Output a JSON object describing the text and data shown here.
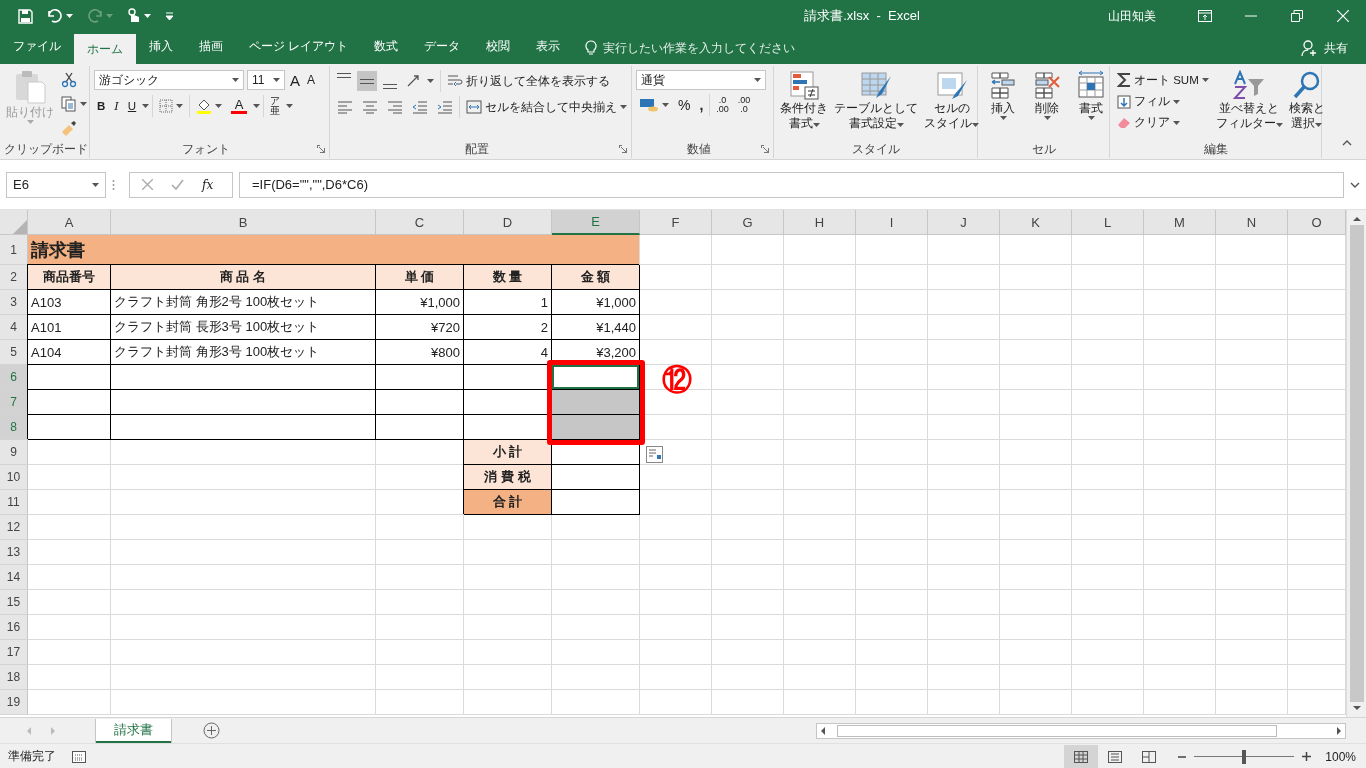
{
  "window": {
    "title": "請求書.xlsx  -  Excel",
    "user": "山田知美"
  },
  "tabs": [
    {
      "label": "ファイル",
      "selected": false
    },
    {
      "label": "ホーム",
      "selected": true
    },
    {
      "label": "挿入",
      "selected": false
    },
    {
      "label": "描画",
      "selected": false
    },
    {
      "label": "ページ レイアウト",
      "selected": false
    },
    {
      "label": "数式",
      "selected": false
    },
    {
      "label": "データ",
      "selected": false
    },
    {
      "label": "校閲",
      "selected": false
    },
    {
      "label": "表示",
      "selected": false
    }
  ],
  "tell_me": {
    "placeholder": "実行したい作業を入力してください"
  },
  "share": "共有",
  "ribbon": {
    "groups": [
      {
        "kind": "clipboard",
        "label": "クリップボード",
        "paste": {
          "label": "貼り付け",
          "disabled": true
        }
      },
      {
        "kind": "font",
        "label": "フォント",
        "font_name": "游ゴシック",
        "font_size": "11",
        "grow": "A",
        "shrink": "A",
        "bold": "B",
        "italic": "I",
        "underline": "U",
        "font_color": "A",
        "phonetic": [
          "ア",
          "亜"
        ]
      },
      {
        "kind": "alignment",
        "label": "配置",
        "vertical": [
          {
            "selected": false
          },
          {
            "selected": true
          },
          {
            "selected": false
          }
        ],
        "wrap": "折り返して全体を表示する",
        "merge": "セルを結合して中央揃え"
      },
      {
        "kind": "number",
        "label": "数値",
        "format": "通貨",
        "percent": "%",
        "comma": ",",
        "increase_decimal": [
          ".0",
          ".00"
        ],
        "decrease_decimal": [
          ".00",
          ".0"
        ]
      },
      {
        "kind": "styles",
        "label": "スタイル",
        "buttons": [
          {
            "lines": [
              "条件付き",
              "書式"
            ]
          },
          {
            "lines": [
              "テーブルとして",
              "書式設定"
            ]
          },
          {
            "lines": [
              "セルの",
              "スタイル"
            ]
          }
        ]
      },
      {
        "kind": "cells",
        "label": "セル",
        "buttons": [
          {
            "label": "挿入"
          },
          {
            "label": "削除"
          },
          {
            "label": "書式"
          }
        ]
      },
      {
        "kind": "editing",
        "label": "編集",
        "autosum": "オート SUM",
        "fill": "フィル",
        "clear": "クリア",
        "buttons": [
          {
            "lines": [
              "並べ替えと",
              "フィルター"
            ]
          },
          {
            "lines": [
              "検索と",
              "選択"
            ]
          }
        ]
      }
    ]
  },
  "formula_bar": {
    "name_box": "E6",
    "fx": "fx",
    "formula": "=IF(D6=\"\",\"\",D6*C6)"
  },
  "sheet": {
    "columns": [
      {
        "label": "A",
        "selected": false
      },
      {
        "label": "B",
        "selected": false
      },
      {
        "label": "C",
        "selected": false
      },
      {
        "label": "D",
        "selected": false
      },
      {
        "label": "E",
        "selected": true
      },
      {
        "label": "F",
        "selected": false
      },
      {
        "label": "G",
        "selected": false
      },
      {
        "label": "H",
        "selected": false
      },
      {
        "label": "I",
        "selected": false
      },
      {
        "label": "J",
        "selected": false
      },
      {
        "label": "K",
        "selected": false
      },
      {
        "label": "L",
        "selected": false
      },
      {
        "label": "M",
        "selected": false
      },
      {
        "label": "N",
        "selected": false
      },
      {
        "label": "O",
        "selected": false
      }
    ],
    "rows": [
      {
        "label": "1",
        "selected": false,
        "cells": [
          {
            "kind": "title",
            "text": "請求書",
            "selected": false
          }
        ]
      },
      {
        "label": "2",
        "selected": false,
        "cells": [
          {
            "kind": "header",
            "text": "商品番号",
            "selected": false
          },
          {
            "kind": "header",
            "text": "商 品 名",
            "selected": false
          },
          {
            "kind": "header",
            "text": "単 価",
            "selected": false
          },
          {
            "kind": "header",
            "text": "数 量",
            "selected": false
          },
          {
            "kind": "header",
            "text": "金 額",
            "selected": false
          }
        ]
      },
      {
        "label": "3",
        "selected": false,
        "cells": [
          {
            "kind": "text",
            "text": "A103",
            "selected": false
          },
          {
            "kind": "text",
            "text": "クラフト封筒 角形2号 100枚セット",
            "selected": false
          },
          {
            "kind": "number",
            "text": "¥1,000",
            "selected": false
          },
          {
            "kind": "number",
            "text": "1",
            "selected": false
          },
          {
            "kind": "number",
            "text": "¥1,000",
            "selected": false
          }
        ]
      },
      {
        "label": "4",
        "selected": false,
        "cells": [
          {
            "kind": "text",
            "text": "A101",
            "selected": false
          },
          {
            "kind": "text",
            "text": "クラフト封筒 長形3号 100枚セット",
            "selected": false
          },
          {
            "kind": "number",
            "text": "¥720",
            "selected": false
          },
          {
            "kind": "number",
            "text": "2",
            "selected": false
          },
          {
            "kind": "number",
            "text": "¥1,440",
            "selected": false
          }
        ]
      },
      {
        "label": "5",
        "selected": false,
        "cells": [
          {
            "kind": "text",
            "text": "A104",
            "selected": false
          },
          {
            "kind": "text",
            "text": "クラフト封筒 角形3号 100枚セット",
            "selected": false
          },
          {
            "kind": "number",
            "text": "¥800",
            "selected": false
          },
          {
            "kind": "number",
            "text": "4",
            "selected": false
          },
          {
            "kind": "number",
            "text": "¥3,200",
            "selected": false
          }
        ]
      },
      {
        "label": "6",
        "selected": true,
        "cells": [
          {
            "kind": "blank",
            "selected": false
          },
          {
            "kind": "blank",
            "selected": false
          },
          {
            "kind": "blank",
            "selected": false
          },
          {
            "kind": "blank",
            "selected": false
          },
          {
            "kind": "blank",
            "selected": true
          }
        ]
      },
      {
        "label": "7",
        "selected": true,
        "cells": [
          {
            "kind": "blank",
            "selected": false
          },
          {
            "kind": "blank",
            "selected": false
          },
          {
            "kind": "blank",
            "selected": false
          },
          {
            "kind": "blank",
            "selected": false
          },
          {
            "kind": "blank",
            "selected": true
          }
        ]
      },
      {
        "label": "8",
        "selected": true,
        "cells": [
          {
            "kind": "blank",
            "selected": false
          },
          {
            "kind": "blank",
            "selected": false
          },
          {
            "kind": "blank",
            "selected": false
          },
          {
            "kind": "blank",
            "selected": false
          },
          {
            "kind": "blank",
            "selected": true
          }
        ]
      },
      {
        "label": "9",
        "selected": false,
        "cells": [
          {
            "kind": "none",
            "selected": false
          },
          {
            "kind": "none",
            "selected": false
          },
          {
            "kind": "none",
            "selected": false
          },
          {
            "kind": "label",
            "text": "小 計",
            "selected": false
          },
          {
            "kind": "blank",
            "selected": false
          }
        ]
      },
      {
        "label": "10",
        "selected": false,
        "cells": [
          {
            "kind": "none",
            "selected": false
          },
          {
            "kind": "none",
            "selected": false
          },
          {
            "kind": "none",
            "selected": false
          },
          {
            "kind": "label",
            "text": "消 費 税",
            "selected": false
          },
          {
            "kind": "blank",
            "selected": false
          }
        ]
      },
      {
        "label": "11",
        "selected": false,
        "cells": [
          {
            "kind": "none",
            "selected": false
          },
          {
            "kind": "none",
            "selected": false
          },
          {
            "kind": "none",
            "selected": false
          },
          {
            "kind": "total-label",
            "text": "合 計",
            "selected": false
          },
          {
            "kind": "blank",
            "selected": false
          }
        ]
      },
      {
        "label": "12",
        "selected": false
      },
      {
        "label": "13",
        "selected": false
      },
      {
        "label": "14",
        "selected": false
      },
      {
        "label": "15",
        "selected": false
      },
      {
        "label": "16",
        "selected": false
      },
      {
        "label": "17",
        "selected": false
      },
      {
        "label": "18",
        "selected": false
      },
      {
        "label": "19",
        "selected": false
      }
    ]
  },
  "annotation": {
    "label": "⑫"
  },
  "sheet_tabs": [
    {
      "label": "請求書",
      "selected": true
    }
  ],
  "status_bar": {
    "text": "準備完了",
    "views": [
      {
        "selected": true
      },
      {
        "selected": false
      },
      {
        "selected": false
      }
    ],
    "zoom_slider": {
      "level": 0.5
    },
    "zoom": "100%"
  }
}
